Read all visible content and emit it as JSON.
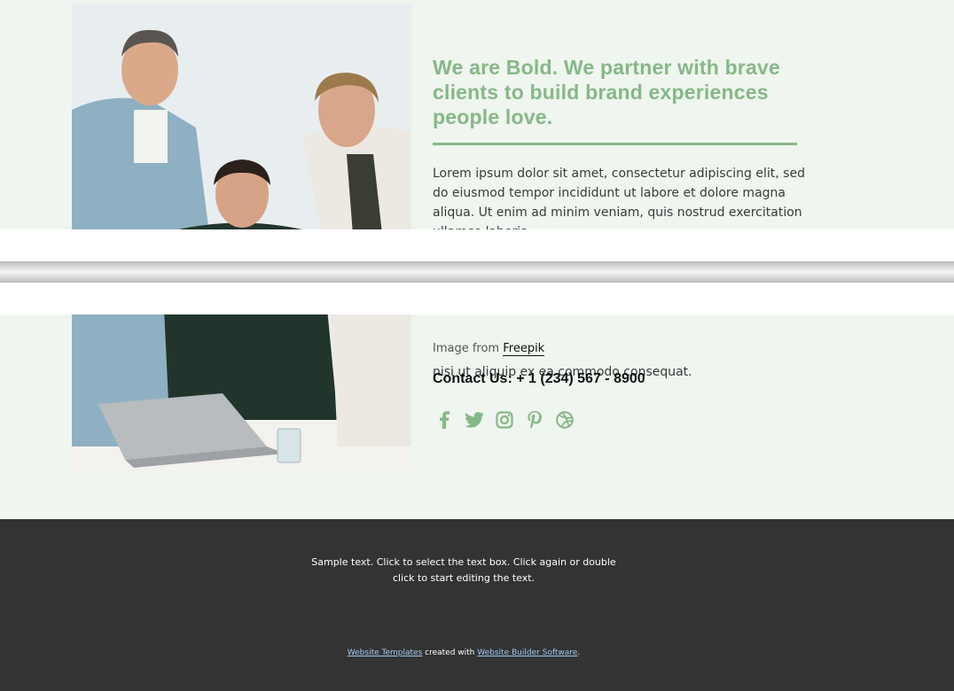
{
  "hero": {
    "headline": "We are Bold. We partner with brave clients to build brand experiences people love.",
    "body_line1": "Lorem ipsum dolor sit amet, consectetur adipiscing elit, sed do eiusmod tempor incididunt ut labore et dolore magna aliqua. Ut enim ad minim veniam, quis nostrud exercitation ullamco laboris",
    "body_line2": "nisi ut aliquip ex ea commodo consequat.",
    "credit_prefix": "Image from ",
    "credit_link": "Freepik",
    "contact": "Contact Us: + 1 (234) 567 - 8900"
  },
  "social": {
    "icons": [
      "facebook-icon",
      "twitter-icon",
      "instagram-icon",
      "pinterest-icon",
      "dribbble-icon"
    ],
    "color": "#86b887"
  },
  "footer": {
    "sample_line1": "Sample text. Click to select the text box. Click again or double",
    "sample_line2": "click to start editing the text.",
    "link1": "Website Templates",
    "middle": " created with ",
    "link2": "Website Builder Software",
    "end": "."
  },
  "colors": {
    "accent": "#86b887",
    "background": "#eff5ef",
    "footer_bg": "#333333"
  }
}
